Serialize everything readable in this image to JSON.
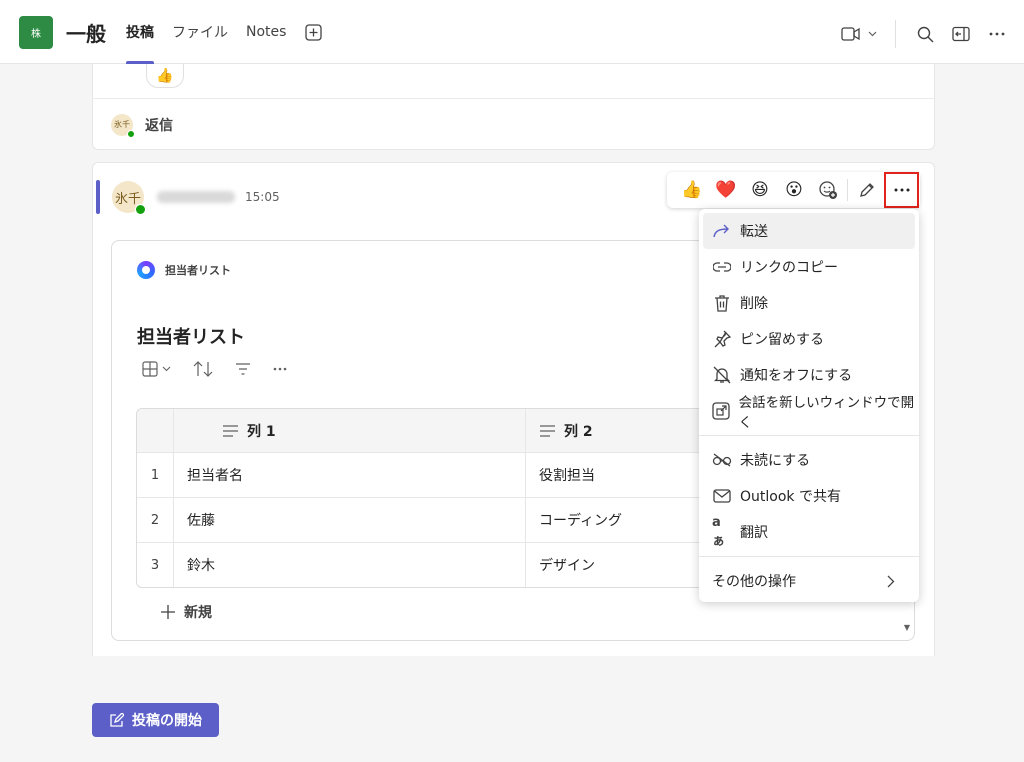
{
  "header": {
    "team_avatar_text": "株",
    "channel_name": "一般",
    "tabs": [
      {
        "label": "投稿",
        "active": true
      },
      {
        "label": "ファイル",
        "active": false
      },
      {
        "label": "Notes",
        "active": false
      }
    ],
    "icons": [
      "add-tab-icon",
      "video-icon",
      "chevron-down-icon",
      "search-icon",
      "side-panel-icon",
      "more-icon"
    ]
  },
  "prev_message": {
    "reaction": "👍",
    "reply_avatar": "氷千",
    "reply_label": "返信"
  },
  "message": {
    "avatar_text": "氷千",
    "time": "15:05",
    "loop": {
      "app_name": "担当者リスト",
      "title": "担当者リスト",
      "columns": [
        "列 1",
        "列 2"
      ],
      "rows": [
        {
          "num": "1",
          "c1": "担当者名",
          "c2": "役割担当"
        },
        {
          "num": "2",
          "c1": "佐藤",
          "c2": "コーディング"
        },
        {
          "num": "3",
          "c1": "鈴木",
          "c2": "デザイン"
        }
      ],
      "new_label": "新規"
    }
  },
  "reactions": [
    "👍",
    "❤️",
    "😆",
    "😮"
  ],
  "menu": {
    "items": [
      {
        "label": "転送",
        "icon": "forward-icon"
      },
      {
        "label": "リンクのコピー",
        "icon": "link-icon"
      },
      {
        "label": "削除",
        "icon": "trash-icon"
      },
      {
        "label": "ピン留めする",
        "icon": "pin-icon"
      },
      {
        "label": "通知をオフにする",
        "icon": "bell-off-icon"
      },
      {
        "label": "会話を新しいウィンドウで開く",
        "icon": "popout-icon"
      },
      {
        "label": "未読にする",
        "icon": "unread-icon"
      },
      {
        "label": "Outlook で共有",
        "icon": "mail-icon"
      },
      {
        "label": "翻訳",
        "icon": "translate-icon"
      },
      {
        "label": "その他の操作",
        "icon": "chevron-right-icon"
      }
    ]
  },
  "start_button": "投稿の開始",
  "colors": {
    "accent": "#5b5fc7",
    "highlight": "#e0231c",
    "team": "#2e8b44"
  }
}
